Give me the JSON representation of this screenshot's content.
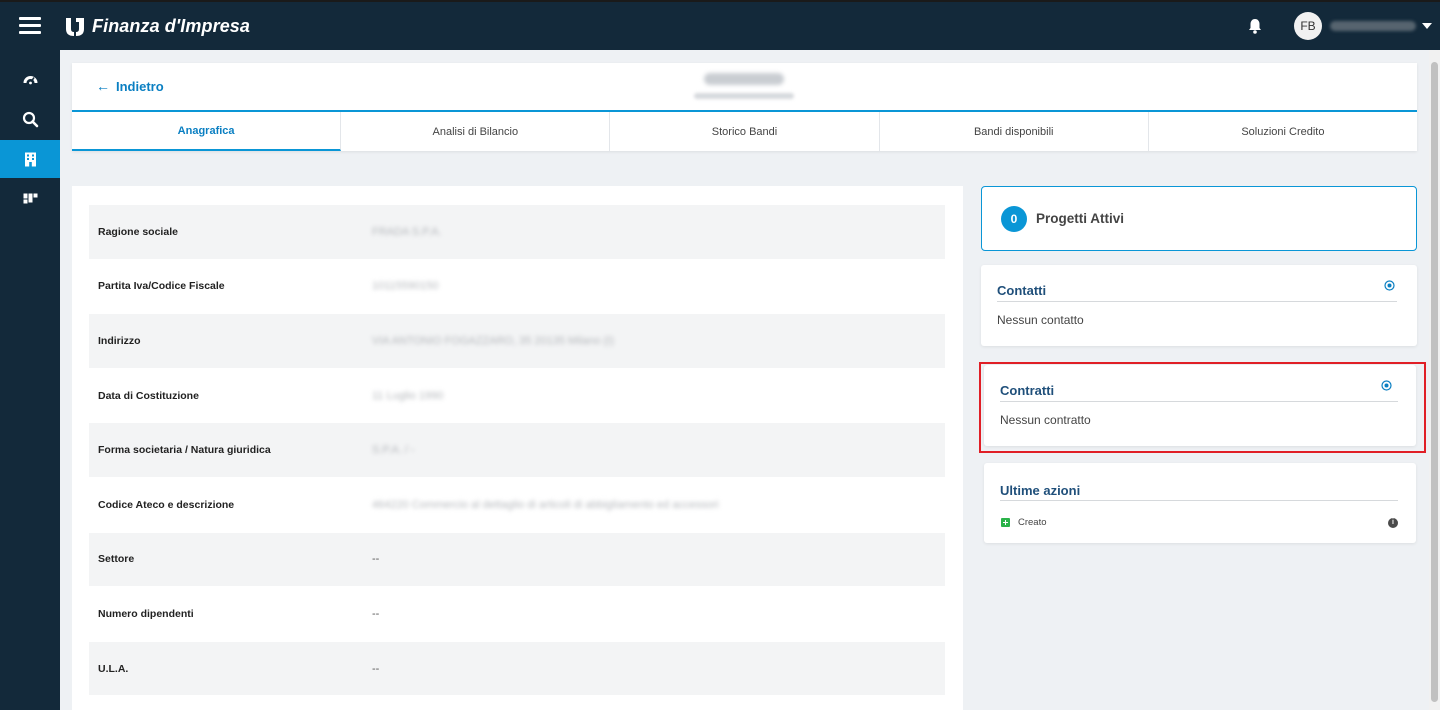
{
  "app": {
    "title": "Finanza d'Impresa",
    "user_initials": "FB"
  },
  "header": {
    "back_label": "Indietro",
    "arrow": "←"
  },
  "tabs": [
    {
      "label": "Anagrafica",
      "active": true
    },
    {
      "label": "Analisi di Bilancio",
      "active": false
    },
    {
      "label": "Storico Bandi",
      "active": false
    },
    {
      "label": "Bandi disponibili",
      "active": false
    },
    {
      "label": "Soluzioni Credito",
      "active": false
    }
  ],
  "info": {
    "rows": [
      {
        "label": "Ragione sociale",
        "value": "FRADA S.P.A.",
        "blurred": true
      },
      {
        "label": "Partita Iva/Codice Fiscale",
        "value": "10115590150",
        "blurred": true
      },
      {
        "label": "Indirizzo",
        "value": "VIA ANTONIO FOGAZZARO, 35 20135 Milano (I)",
        "blurred": true
      },
      {
        "label": "Data di Costituzione",
        "value": "11 Luglio 1990",
        "blurred": true
      },
      {
        "label": "Forma societaria / Natura giuridica",
        "value": "S.P.A. / -",
        "blurred": true
      },
      {
        "label": "Codice Ateco e descrizione",
        "value": "464220 Commercio al dettaglio di articoli di abbigliamento ed accessori",
        "blurred": true
      },
      {
        "label": "Settore",
        "value": "--",
        "blurred": false
      },
      {
        "label": "Numero dipendenti",
        "value": "--",
        "blurred": false
      },
      {
        "label": "U.L.A.",
        "value": "--",
        "blurred": false
      }
    ]
  },
  "progetti": {
    "count": "0",
    "title": "Progetti Attivi"
  },
  "contatti": {
    "title": "Contatti",
    "empty": "Nessun contatto"
  },
  "contratti": {
    "title": "Contratti",
    "empty": "Nessun contratto"
  },
  "ultime_azioni": {
    "title": "Ultime azioni",
    "items": [
      {
        "label": "Creato"
      }
    ]
  },
  "colors": {
    "topbar": "#13293a",
    "accent": "#0a96d6",
    "highlight": "#e01f26",
    "success": "#2bb34a"
  }
}
